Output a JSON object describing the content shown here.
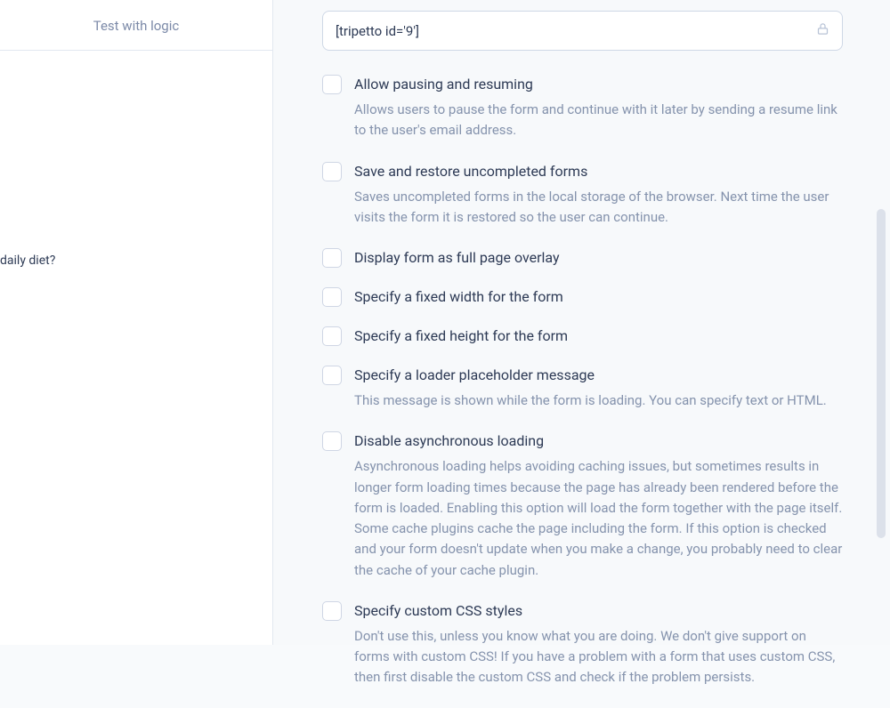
{
  "left": {
    "link": "Test with logic",
    "question_fragment": "daily diet?"
  },
  "main": {
    "shortcode": "[tripetto id='9']",
    "options": [
      {
        "title": "Allow pausing and resuming",
        "desc": "Allows users to pause the form and continue with it later by sending a resume link to the user's email address."
      },
      {
        "title": "Save and restore uncompleted forms",
        "desc": "Saves uncompleted forms in the local storage of the browser. Next time the user visits the form it is restored so the user can continue."
      },
      {
        "title": "Display form as full page overlay",
        "desc": ""
      },
      {
        "title": "Specify a fixed width for the form",
        "desc": ""
      },
      {
        "title": "Specify a fixed height for the form",
        "desc": ""
      },
      {
        "title": "Specify a loader placeholder message",
        "desc": "This message is shown while the form is loading. You can specify text or HTML."
      },
      {
        "title": "Disable asynchronous loading",
        "desc": "Asynchronous loading helps avoiding caching issues, but sometimes results in longer form loading times because the page has already been rendered before the form is loaded. Enabling this option will load the form together with the page itself. Some cache plugins cache the page including the form. If this option is checked and your form doesn't update when you make a change, you probably need to clear the cache of your cache plugin."
      },
      {
        "title": "Specify custom CSS styles",
        "desc": "Don't use this, unless you know what you are doing. We don't give support on forms with custom CSS! If you have a problem with a form that uses custom CSS, then first disable the custom CSS and check if the problem persists."
      }
    ]
  }
}
